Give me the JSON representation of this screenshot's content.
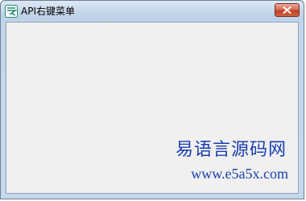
{
  "window": {
    "title": "API右键菜单",
    "app_icon": "app-logo-icon",
    "close_icon": "close-icon"
  },
  "watermark": {
    "name": "易语言源码网",
    "url": "www.e5a5x.com"
  },
  "colors": {
    "title_bar": "#c9d9ec",
    "close_button": "#c9462b",
    "client_area": "#f0f0f0",
    "watermark": "#1a3fb0"
  }
}
